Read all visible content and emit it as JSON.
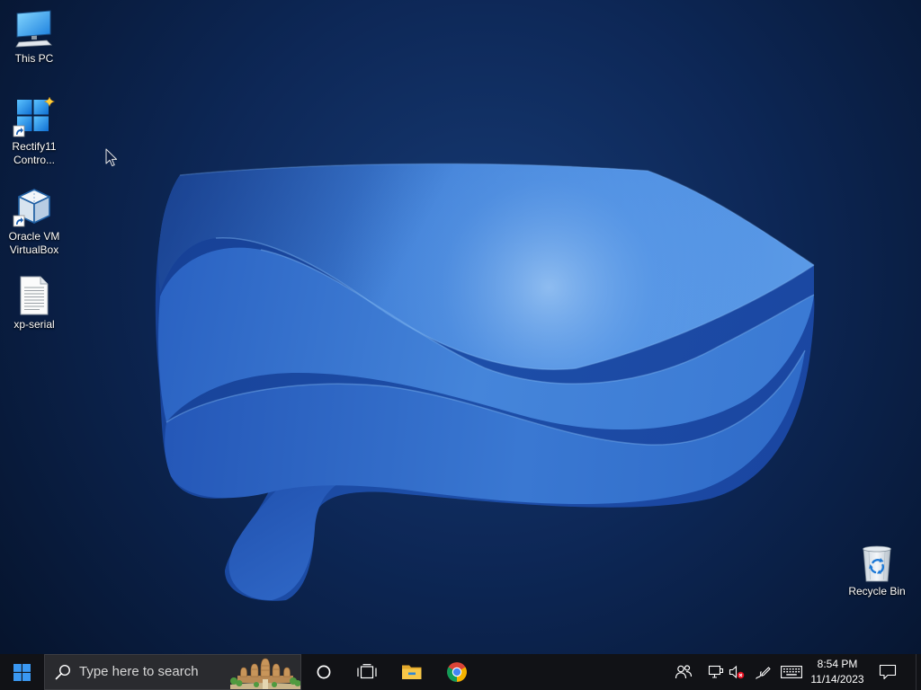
{
  "desktop": {
    "icons": [
      {
        "label_lines": [
          "This PC"
        ],
        "icon": "this-pc-icon",
        "shortcut": false
      },
      {
        "label_lines": [
          "Rectify11",
          "Contro..."
        ],
        "icon": "rectify11-control-center-icon",
        "shortcut": true
      },
      {
        "label_lines": [
          "Oracle VM",
          "VirtualBox"
        ],
        "icon": "virtualbox-icon",
        "shortcut": true
      },
      {
        "label_lines": [
          "xp-serial"
        ],
        "icon": "text-document-icon",
        "shortcut": false
      }
    ],
    "recycle_bin": {
      "label_lines": [
        "Recycle Bin"
      ],
      "icon": "recycle-bin-icon"
    },
    "cursor_icon": "mouse-pointer-icon"
  },
  "taskbar": {
    "start_button": {
      "icon": "windows-logo-icon"
    },
    "search": {
      "icon": "search-icon",
      "placeholder": "Type here to search",
      "highlight_icon": "search-highlight-temple-icon"
    },
    "buttons": [
      {
        "icon": "cortana-icon"
      },
      {
        "icon": "task-view-icon"
      },
      {
        "icon": "file-explorer-icon"
      },
      {
        "icon": "chrome-icon"
      }
    ],
    "tray": {
      "icons": [
        "people-icon",
        "network-icon",
        "volume-muted-icon",
        "windows-ink-icon",
        "touch-keyboard-icon"
      ],
      "clock": {
        "time": "8:54 PM",
        "date": "11/14/2023"
      },
      "action_center_icon": "action-center-icon"
    }
  },
  "colors": {
    "taskbar_bg": "#111216",
    "search_bg": "#2a2b2f",
    "accent_blue": "#0078d4",
    "wallpaper_bg": "#0b2150",
    "bloom_blue": "#3f7fd6",
    "mute_red": "#e81123",
    "label_text": "#ffffff"
  }
}
